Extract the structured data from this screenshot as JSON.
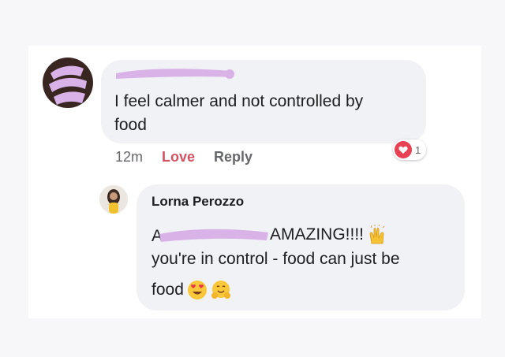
{
  "comment1": {
    "author_redacted": true,
    "text_line1": "I feel calmer and not controlled by",
    "text_line2": "food",
    "time": "12m",
    "love_label": "Love",
    "reply_label": "Reply",
    "reaction_icon": "heart-reaction-icon",
    "reaction_count": "1"
  },
  "comment2": {
    "author": "Lorna Perozzo",
    "mention_redacted": true,
    "line1_text": "AMAZING!!!!",
    "line2_text": "you're in control - food can just be",
    "line3_text": "food",
    "emojis": [
      "raising-hands-icon",
      "heart-eyes-icon",
      "hugging-face-icon"
    ]
  },
  "colors": {
    "bubble": "#f0f2f5",
    "love": "#d35262",
    "redaction": "#d9b3e8",
    "heart": "#e84153"
  }
}
